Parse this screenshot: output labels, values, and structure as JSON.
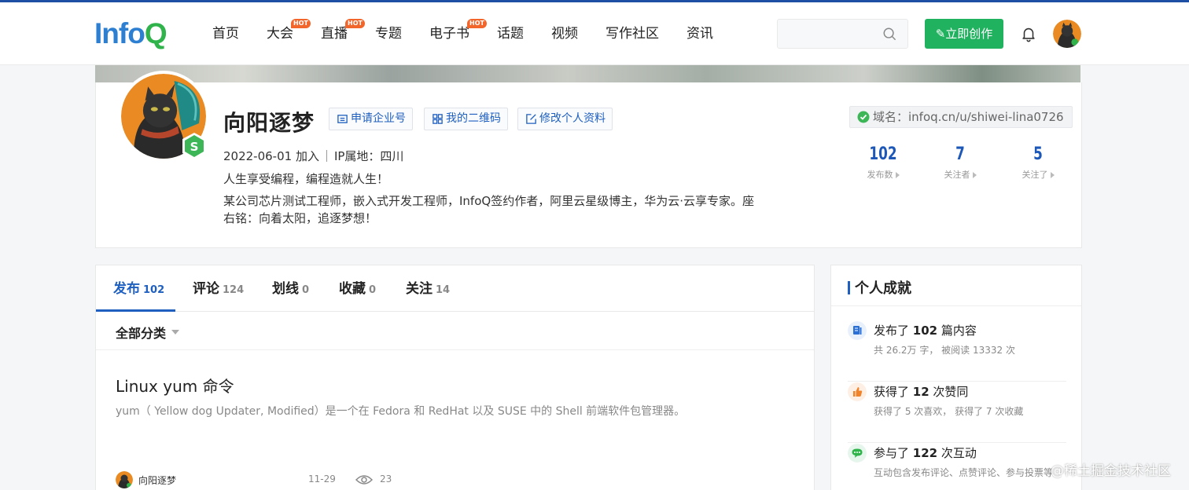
{
  "header": {
    "logo_main": "Info",
    "logo_q": "Q",
    "nav": [
      {
        "label": "首页",
        "hot": ""
      },
      {
        "label": "大会",
        "hot": "HOT"
      },
      {
        "label": "直播",
        "hot": "HOT"
      },
      {
        "label": "专题",
        "hot": ""
      },
      {
        "label": "电子书",
        "hot": "HOT"
      },
      {
        "label": "话题",
        "hot": ""
      },
      {
        "label": "视频",
        "hot": ""
      },
      {
        "label": "写作社区",
        "hot": ""
      },
      {
        "label": "资讯",
        "hot": ""
      }
    ],
    "search_value": "",
    "create_label": "立即创作"
  },
  "profile": {
    "name": "向阳逐梦",
    "actions": {
      "enterprise": "申请企业号",
      "qrcode": "我的二维码",
      "edit": "修改个人资料"
    },
    "joined": "2022-06-01 加入",
    "ip": "IP属地：四川",
    "slogan": "人生享受编程，编程造就人生！",
    "bio": "某公司芯片测试工程师，嵌入式开发工程师，InfoQ签约作者，阿里云星级博主，华为云·云享专家。座右铭：向着太阳，追逐梦想！",
    "domain": "域名：infoq.cn/u/shiwei-lina0726",
    "stats": {
      "posts": {
        "value": "102",
        "label": "发布数"
      },
      "followers": {
        "value": "7",
        "label": "关注者"
      },
      "following": {
        "value": "5",
        "label": "关注了"
      }
    }
  },
  "tabs": [
    {
      "label": "发布",
      "count": "102"
    },
    {
      "label": "评论",
      "count": "124"
    },
    {
      "label": "划线",
      "count": "0"
    },
    {
      "label": "收藏",
      "count": "0"
    },
    {
      "label": "关注",
      "count": "14"
    }
  ],
  "category": "全部分类",
  "article": {
    "title": "Linux yum 命令",
    "desc": "yum（ Yellow dog Updater, Modified）是一个在 Fedora 和 RedHat 以及 SUSE 中的 Shell 前端软件包管理器。",
    "author": "向阳逐梦",
    "date": "11-29",
    "views": "23"
  },
  "achievements": {
    "title": "个人成就",
    "items": [
      {
        "pre": "发布了 ",
        "num": "102",
        "post": " 篇内容",
        "sub": "共 26.2万 字， 被阅读 13332 次"
      },
      {
        "pre": "获得了 ",
        "num": "12",
        "post": " 次赞同",
        "sub": "获得了 5 次喜欢， 获得了 7 次收藏"
      },
      {
        "pre": "参与了 ",
        "num": "122",
        "post": " 次互动",
        "sub": "互动包含发布评论、点赞评论、参与投票等"
      }
    ]
  },
  "watermark": "@稀土掘金技术社区",
  "colors": {
    "brand_blue": "#1e5fbf",
    "create_green": "#21b25f",
    "hot_orange": "#f2652b"
  }
}
